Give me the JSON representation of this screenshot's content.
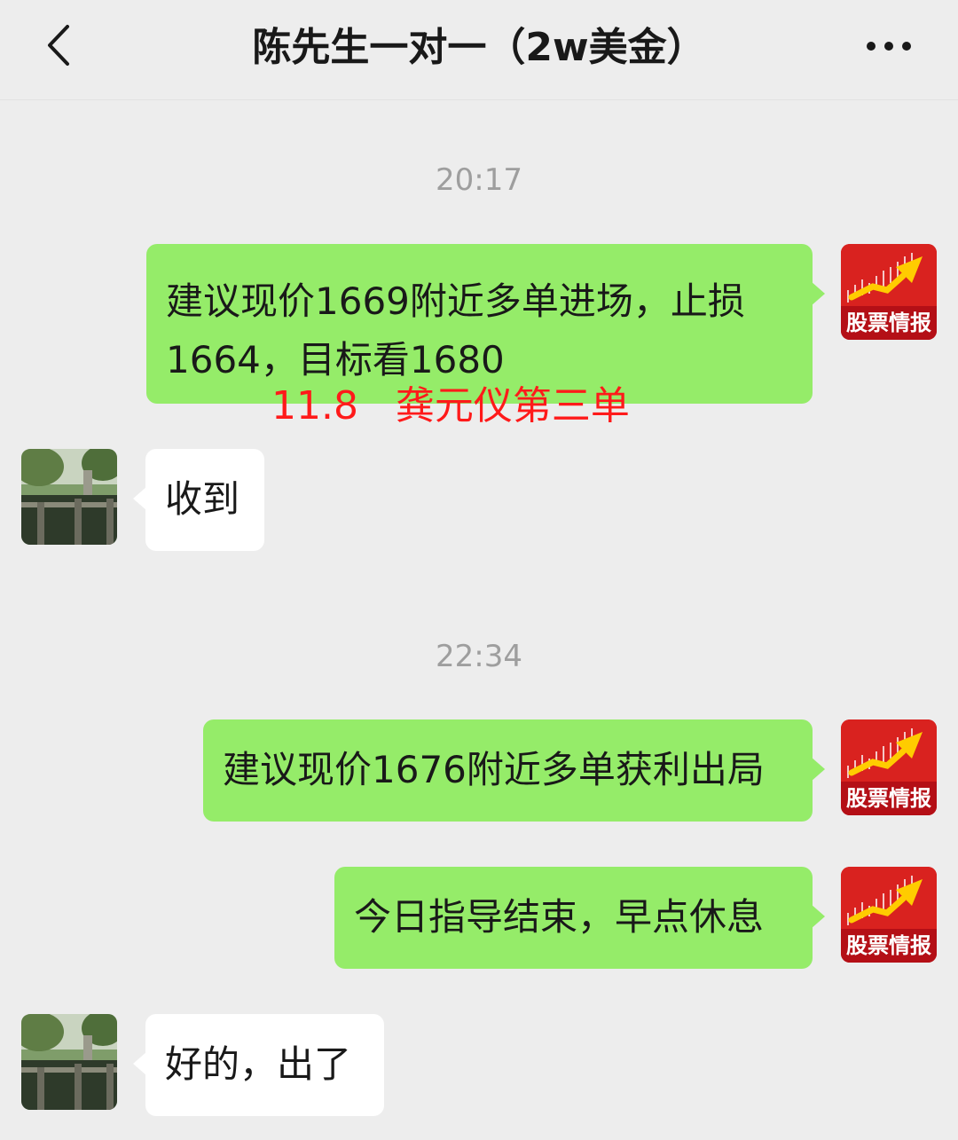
{
  "header": {
    "title": "陈先生一对一（2w美金）",
    "back_icon": "chevron-left-icon",
    "more_icon": "more-dots-icon"
  },
  "messages": {
    "time1": "20:17",
    "m1_line1": "建议现价1669附近多单进场，止损",
    "m1_line2": "1664，目标看1680",
    "annotation": "11.8   龚元仪第三单",
    "m2": "收到",
    "time2": "22:34",
    "m3": "建议现价1676附近多单获利出局",
    "m4": "今日指导结束，早点休息",
    "m5": "好的，出了"
  },
  "sender_avatar": {
    "label": "股票情报"
  },
  "colors": {
    "background": "#ededed",
    "outgoing_bubble": "#95ec69",
    "incoming_bubble": "#ffffff",
    "annotation": "#ff1a1a"
  }
}
